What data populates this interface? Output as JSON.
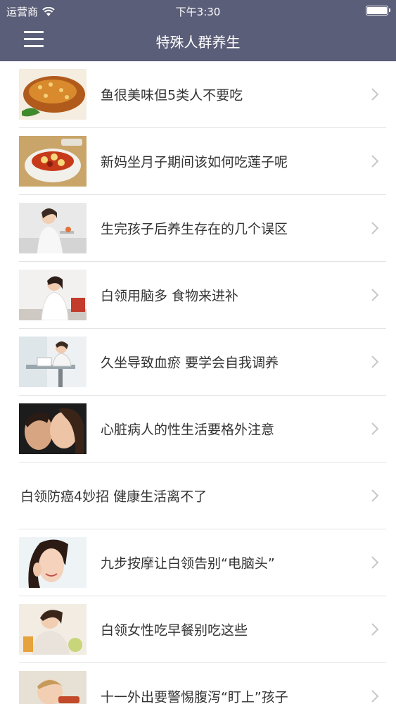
{
  "status": {
    "carrier": "运营商",
    "time": "下午3:30"
  },
  "nav": {
    "title": "特殊人群养生",
    "menu_icon": "hamburger-menu-icon"
  },
  "items": [
    {
      "title": "鱼很美味但5类人不要吃",
      "thumb": "fish-dish"
    },
    {
      "title": "新妈坐月子期间该如何吃莲子呢",
      "thumb": "lotus-seed-soup"
    },
    {
      "title": "生完孩子后养生存在的几个误区",
      "thumb": "woman-eating"
    },
    {
      "title": "白领用脑多 食物来进补",
      "thumb": "office-woman"
    },
    {
      "title": "久坐导致血瘀 要学会自我调养",
      "thumb": "woman-at-desk"
    },
    {
      "title": "心脏病人的性生活要格外注意",
      "thumb": "couple-kissing"
    },
    {
      "title": "白领防癌4妙招 健康生活离不了",
      "thumb": ""
    },
    {
      "title": "九步按摩让白领告别“电脑头”",
      "thumb": "woman-face-massage"
    },
    {
      "title": "白领女性吃早餐别吃这些",
      "thumb": "woman-breakfast"
    },
    {
      "title": "十一外出要警惕腹泻“盯上”孩子",
      "thumb": "child-eating"
    }
  ],
  "colors": {
    "header_bg": "#5b5e78",
    "text": "#333333",
    "divider": "#e3e3e3",
    "chevron": "#c7c7cc"
  }
}
